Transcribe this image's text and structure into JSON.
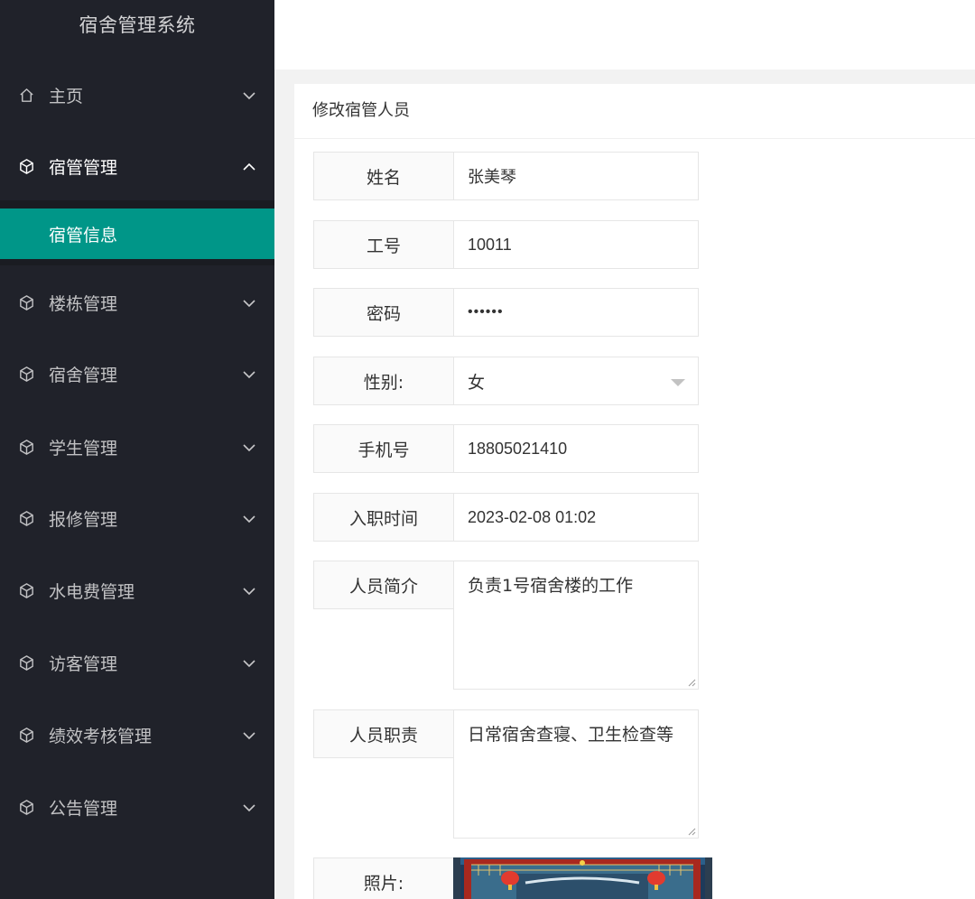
{
  "sidebar": {
    "title": "宿舍管理系统",
    "items": [
      {
        "label": "主页",
        "icon": "home-icon"
      },
      {
        "label": "宿管管理",
        "icon": "cube-icon",
        "expanded": true
      },
      {
        "label": "楼栋管理",
        "icon": "cube-icon"
      },
      {
        "label": "宿舍管理",
        "icon": "cube-icon"
      },
      {
        "label": "学生管理",
        "icon": "cube-icon"
      },
      {
        "label": "报修管理",
        "icon": "cube-icon"
      },
      {
        "label": "水电费管理",
        "icon": "cube-icon"
      },
      {
        "label": "访客管理",
        "icon": "cube-icon"
      },
      {
        "label": "绩效考核管理",
        "icon": "cube-icon"
      },
      {
        "label": "公告管理",
        "icon": "cube-icon"
      }
    ],
    "submenu": {
      "label": "宿管信息",
      "active": true
    }
  },
  "form": {
    "title": "修改宿管人员",
    "name": {
      "label": "姓名",
      "value": "张美琴"
    },
    "job_number": {
      "label": "工号",
      "value": "10011"
    },
    "password": {
      "label": "密码",
      "value": "••••••"
    },
    "gender": {
      "label": "性别:",
      "value": "女"
    },
    "phone": {
      "label": "手机号",
      "value": "18805021410"
    },
    "hire_time": {
      "label": "入职时间",
      "value": "2023-02-08 01:02"
    },
    "intro": {
      "label": "人员简介",
      "value": "负责1号宿舍楼的工作"
    },
    "duty": {
      "label": "人员职责",
      "value": "日常宿舍查寝、卫生检查等"
    },
    "photo": {
      "label": "照片:"
    }
  },
  "colors": {
    "sidebar_bg": "#20222a",
    "accent": "#009688"
  }
}
